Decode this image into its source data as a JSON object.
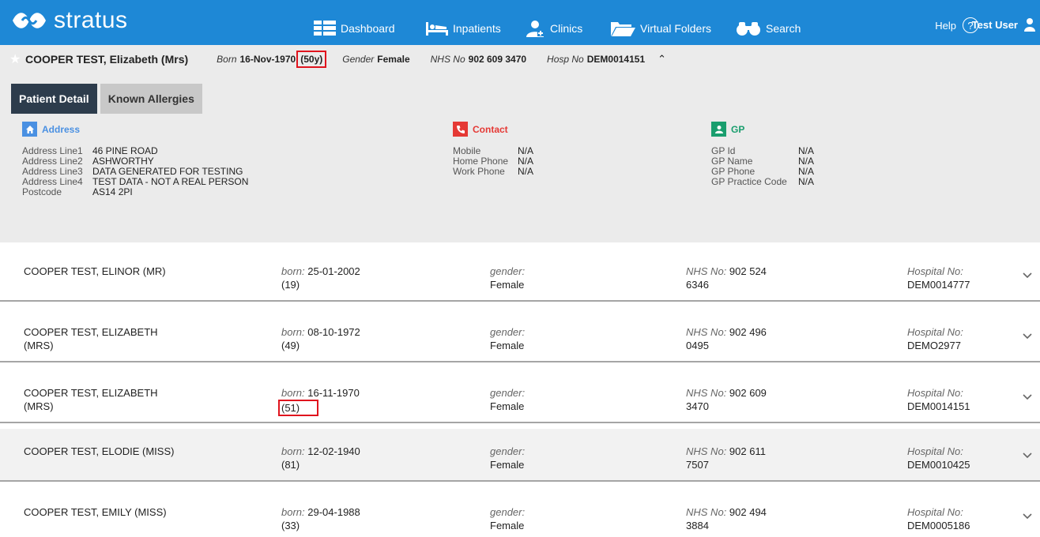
{
  "header": {
    "logo_text": "stratus",
    "nav": [
      {
        "label": "Dashboard",
        "icon": "dashboard-icon"
      },
      {
        "label": "Inpatients",
        "icon": "bed-icon"
      },
      {
        "label": "Clinics",
        "icon": "clinic-icon"
      },
      {
        "label": "Virtual Folders",
        "icon": "folder-icon"
      },
      {
        "label": "Search",
        "icon": "binoculars-icon"
      }
    ],
    "help_label": "Help",
    "help_glyph": "?",
    "user_label": "Test User"
  },
  "patient": {
    "name": "COOPER TEST, Elizabeth (Mrs)",
    "born_label": "Born",
    "born_value": "16-Nov-1970",
    "age": "(50y)",
    "gender_label": "Gender",
    "gender_value": "Female",
    "nhs_label": "NHS No",
    "nhs_value": "902 609 3470",
    "hosp_label": "Hosp No",
    "hosp_value": "DEM0014151"
  },
  "tabs": [
    {
      "label": "Patient Detail",
      "active": true
    },
    {
      "label": "Known Allergies",
      "active": false
    }
  ],
  "address": {
    "title": "Address",
    "color": "#4a90e2",
    "rows": [
      {
        "k": "Address Line1",
        "v": "46 PINE ROAD"
      },
      {
        "k": "Address Line2",
        "v": "ASHWORTHY"
      },
      {
        "k": "Address Line3",
        "v": "DATA GENERATED FOR TESTING"
      },
      {
        "k": "Address Line4",
        "v": "TEST DATA - NOT A REAL PERSON"
      },
      {
        "k": "Postcode",
        "v": "AS14 2PI"
      }
    ]
  },
  "contact": {
    "title": "Contact",
    "color": "#e53935",
    "rows": [
      {
        "k": "Mobile",
        "v": "N/A"
      },
      {
        "k": "Home Phone",
        "v": "N/A"
      },
      {
        "k": "Work Phone",
        "v": "N/A"
      }
    ]
  },
  "gp": {
    "title": "GP",
    "color": "#1a9e6e",
    "rows": [
      {
        "k": "GP Id",
        "v": "N/A"
      },
      {
        "k": "GP Name",
        "v": "N/A"
      },
      {
        "k": "GP Phone",
        "v": "N/A"
      },
      {
        "k": "GP Practice Code",
        "v": "N/A"
      }
    ]
  },
  "results": {
    "born_label": "born:",
    "gender_label": "gender:",
    "nhs_label": "NHS No:",
    "hosp_label": "Hospital No:",
    "rows": [
      {
        "name": "COOPER TEST, ELINOR (MR)",
        "born": "25-01-2002",
        "age": "(19)",
        "gender": "Female",
        "nhs1": "902 524",
        "nhs2": "6346",
        "hosp": "DEM0014777"
      },
      {
        "name": "COOPER TEST, ELIZABETH (MRS)",
        "born": "08-10-1972",
        "age": "(49)",
        "gender": "Female",
        "nhs1": "902 496",
        "nhs2": "0495",
        "hosp": "DEMO2977"
      },
      {
        "name": "COOPER TEST, ELIZABETH (MRS)",
        "born": "16-11-1970",
        "age": "(51)",
        "gender": "Female",
        "nhs1": "902 609",
        "nhs2": "3470",
        "hosp": "DEM0014151"
      },
      {
        "name": "COOPER TEST, ELODIE (MISS)",
        "born": "12-02-1940",
        "age": "(81)",
        "gender": "Female",
        "nhs1": "902 611",
        "nhs2": "7507",
        "hosp": "DEM0010425"
      },
      {
        "name": "COOPER TEST, EMILY (MISS)",
        "born": "29-04-1988",
        "age": "(33)",
        "gender": "Female",
        "nhs1": "902 494",
        "nhs2": "3884",
        "hosp": "DEM0005186"
      }
    ]
  }
}
